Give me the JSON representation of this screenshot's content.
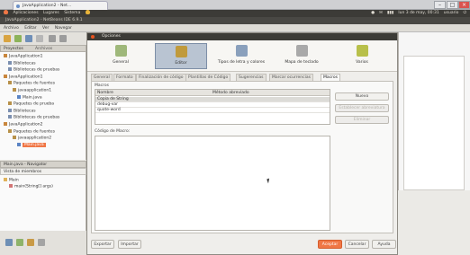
{
  "browser": {
    "tab_title": "JavaApplication2 - Net...",
    "window_buttons": [
      "–",
      "□",
      "×"
    ]
  },
  "ubuntu_panel": {
    "menus": [
      "Aplicaciones",
      "Lugares",
      "Sistema"
    ],
    "tray": [
      "●",
      "✉",
      "▮▮▮",
      "lun 3 de may, 00:31",
      "usuario",
      "⏻"
    ]
  },
  "netbeans": {
    "title": "JavaApplication2 - NetBeans IDE 6.9.1",
    "menubar": [
      "Archivo",
      "Editar",
      "Ver",
      "Navegar"
    ]
  },
  "projects_panel": {
    "tabs": [
      "Proyectos",
      "Archivos"
    ],
    "tree": [
      {
        "label": "JavaApplication1",
        "depth": 0,
        "icon": "coffee"
      },
      {
        "label": "Bibliotecas",
        "depth": 1,
        "icon": "library"
      },
      {
        "label": "Bibliotecas de pruebas",
        "depth": 1,
        "icon": "library"
      },
      {
        "label": "JavaApplication1",
        "depth": 0,
        "icon": "coffee"
      },
      {
        "label": "Paquetes de fuentes",
        "depth": 1,
        "icon": "package"
      },
      {
        "label": "javaapplication1",
        "depth": 2,
        "icon": "package"
      },
      {
        "label": "Main.java",
        "depth": 3,
        "icon": "java"
      },
      {
        "label": "Paquetes de prueba",
        "depth": 1,
        "icon": "package"
      },
      {
        "label": "Bibliotecas",
        "depth": 1,
        "icon": "library"
      },
      {
        "label": "Bibliotecas de pruebas",
        "depth": 1,
        "icon": "library"
      },
      {
        "label": "JavaApplication2",
        "depth": 0,
        "icon": "coffee"
      },
      {
        "label": "Paquetes de fuentes",
        "depth": 1,
        "icon": "package"
      },
      {
        "label": "javaapplication2",
        "depth": 2,
        "icon": "package"
      },
      {
        "label": "Main.java",
        "depth": 3,
        "icon": "java",
        "selected": true
      }
    ]
  },
  "navigator_panel": {
    "title": "Main.java - Navigator",
    "filter": "Vista de miembros",
    "tree": [
      {
        "label": "Main",
        "depth": 0
      },
      {
        "label": "main(String[] args)",
        "depth": 1
      }
    ]
  },
  "dialog": {
    "title": "Opciones",
    "categories": [
      {
        "label": "General",
        "color": "#9fb87a"
      },
      {
        "label": "Editor",
        "color": "#c09a3c",
        "active": true
      },
      {
        "label": "Tipos de letra y colores",
        "color": "#8aa0bc"
      },
      {
        "label": "Mapa de teclado",
        "color": "#a9a9a9"
      },
      {
        "label": "Varios",
        "color": "#b8c04a"
      }
    ],
    "tabs": [
      "General",
      "Formato",
      "Finalización de código",
      "Plantillas de Código",
      "Sugerencias",
      "Marcar ocurrencias",
      "Macros"
    ],
    "active_tab": "Macros",
    "macros_label": "Macros",
    "table_headers": [
      "Nombre",
      "Método abreviado"
    ],
    "macros": [
      {
        "name": "Copia de String",
        "shortcut": ""
      },
      {
        "name": "debug-var",
        "shortcut": ""
      },
      {
        "name": "quote-word",
        "shortcut": ""
      }
    ],
    "side_buttons": [
      {
        "label": "Nuevo",
        "enabled": true
      },
      {
        "label": "Establecer abreviatura",
        "enabled": false
      },
      {
        "label": "Eliminar",
        "enabled": false
      }
    ],
    "code_label": "Código de Macro:",
    "code": "",
    "footer_left": [
      "Exportar",
      "Importar"
    ],
    "footer_right": [
      {
        "label": "Aceptar",
        "primary": true
      },
      {
        "label": "Cancelar",
        "primary": false
      },
      {
        "label": "Ayuda",
        "primary": false
      }
    ]
  },
  "colors": {
    "accent": "#f07746",
    "panel_dark": "#3c3b37"
  }
}
